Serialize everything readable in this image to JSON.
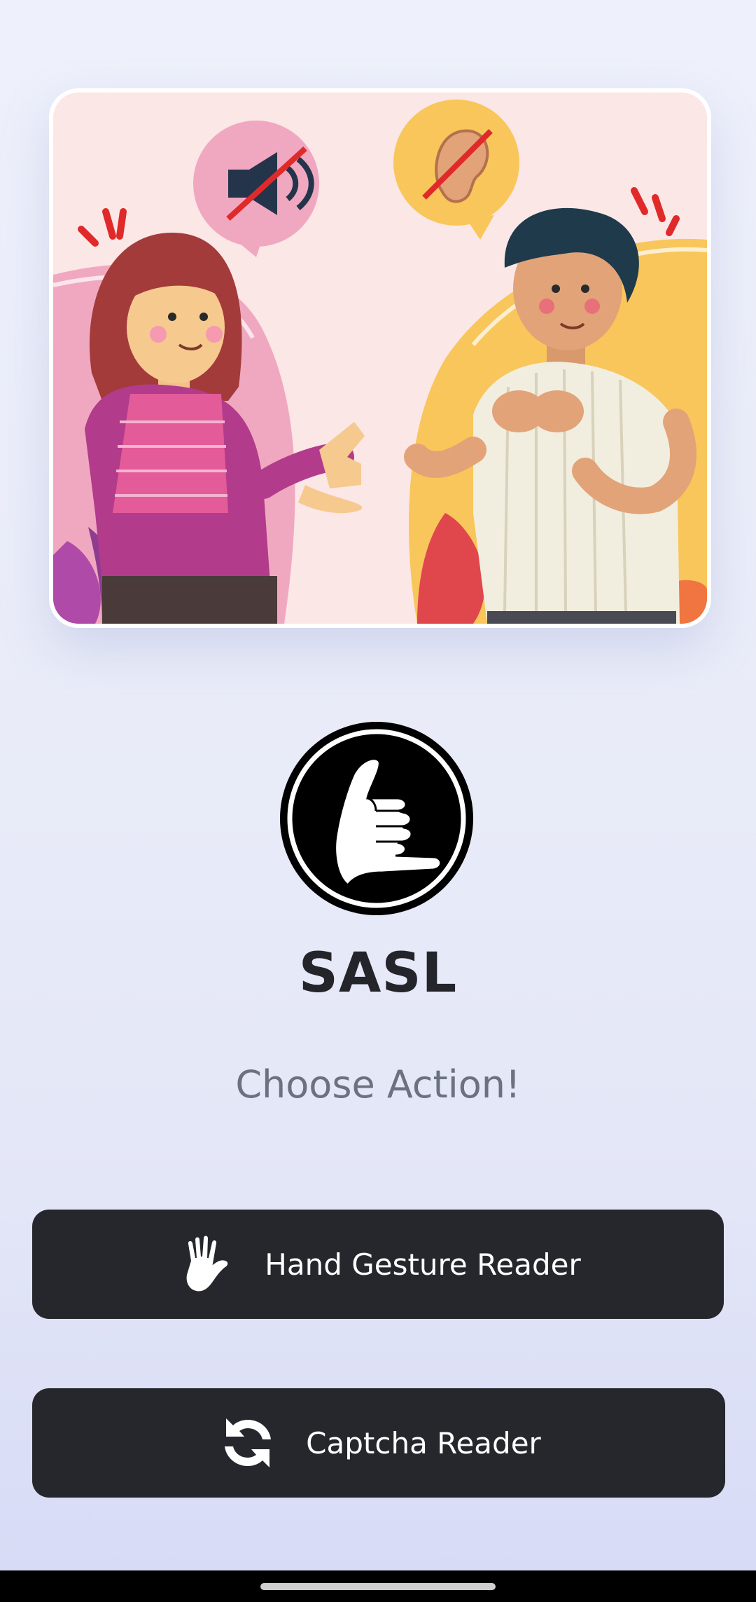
{
  "app": {
    "title": "SASL",
    "subtitle": "Choose Action!"
  },
  "hero": {
    "illustration": "two-people-sign-language-illustration",
    "icons": [
      "muted-speaker-icon",
      "crossed-ear-icon"
    ]
  },
  "logo": {
    "icon": "hand-sign-logo-icon"
  },
  "actions": [
    {
      "label": "Hand Gesture Reader",
      "icon": "hand-icon"
    },
    {
      "label": "Captcha Reader",
      "icon": "refresh-icon"
    }
  ],
  "colors": {
    "button_bg": "#26272c",
    "title": "#23252b",
    "subtitle": "#6b7180",
    "hero_bg": "#fbe7e6"
  }
}
